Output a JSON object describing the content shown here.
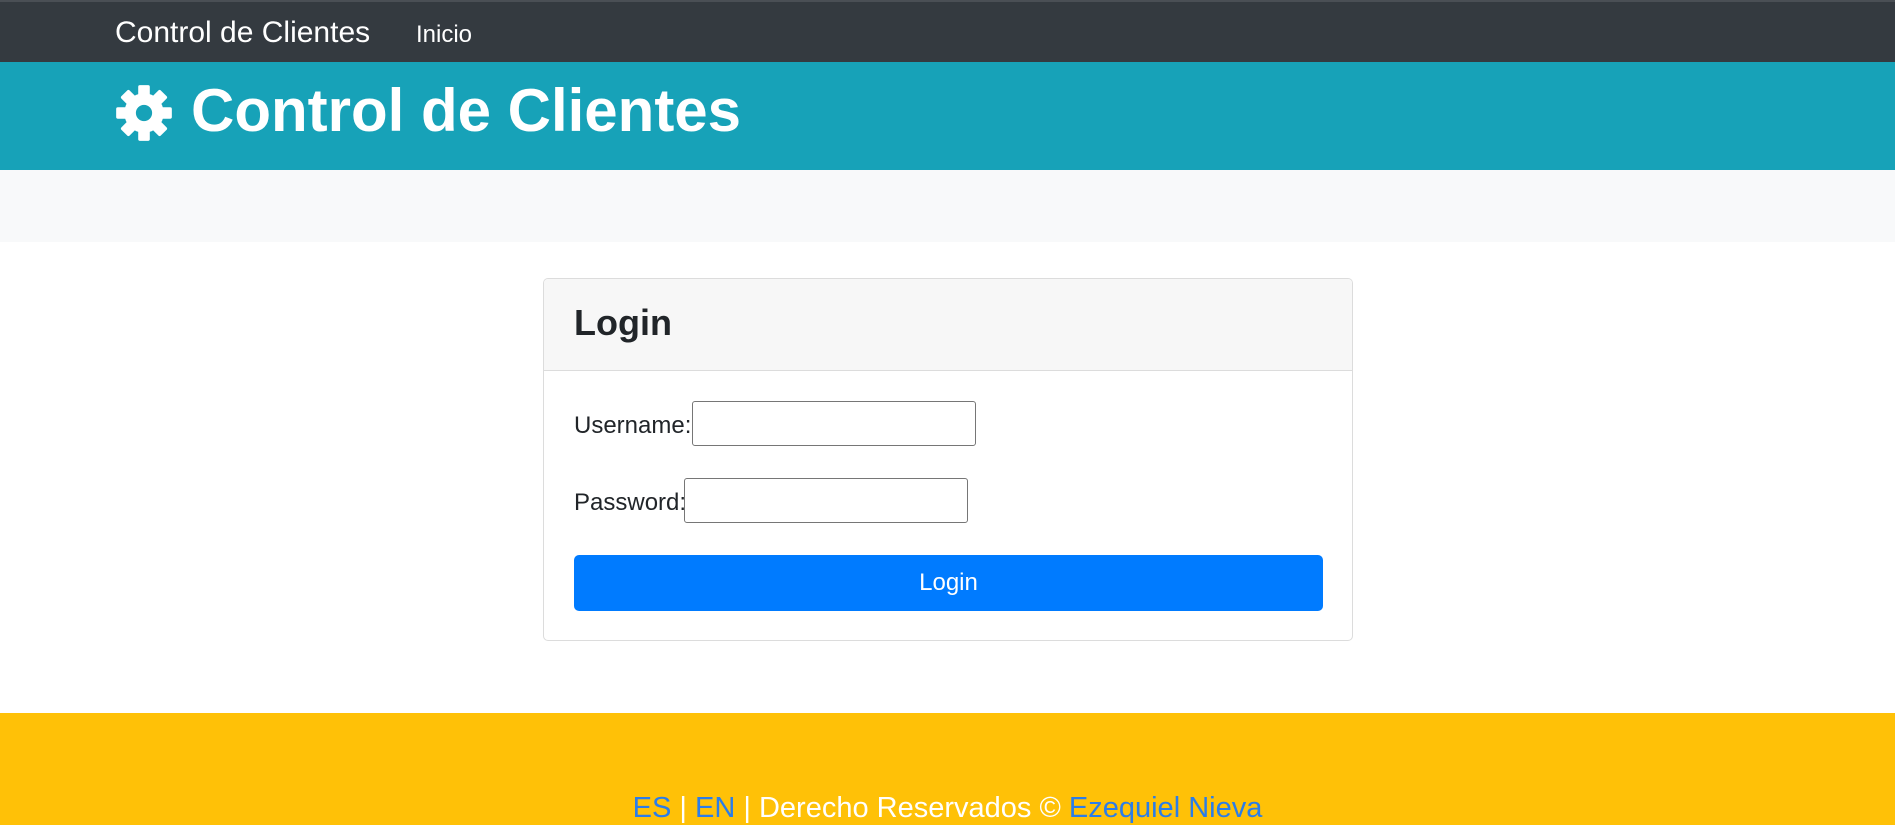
{
  "navbar": {
    "brand": "Control de Clientes",
    "links": [
      "Inicio"
    ]
  },
  "header": {
    "icon": "gear-icon",
    "title": "Control de Clientes"
  },
  "login_card": {
    "title": "Login",
    "username_label": "Username:",
    "username_value": "",
    "password_label": "Password:",
    "password_value": "",
    "submit_label": "Login"
  },
  "footer": {
    "lang_es": "ES",
    "separator": "|",
    "lang_en": "EN",
    "rights_text": "Derecho Reservados ©",
    "author": "Ezequiel Nieva"
  },
  "colors": {
    "navbar_bg": "#343a40",
    "header_bg": "#17a2b8",
    "subbar_bg": "#f8f9fa",
    "primary_button": "#007bff",
    "footer_bg": "#ffc107",
    "link": "#2b7de9"
  }
}
